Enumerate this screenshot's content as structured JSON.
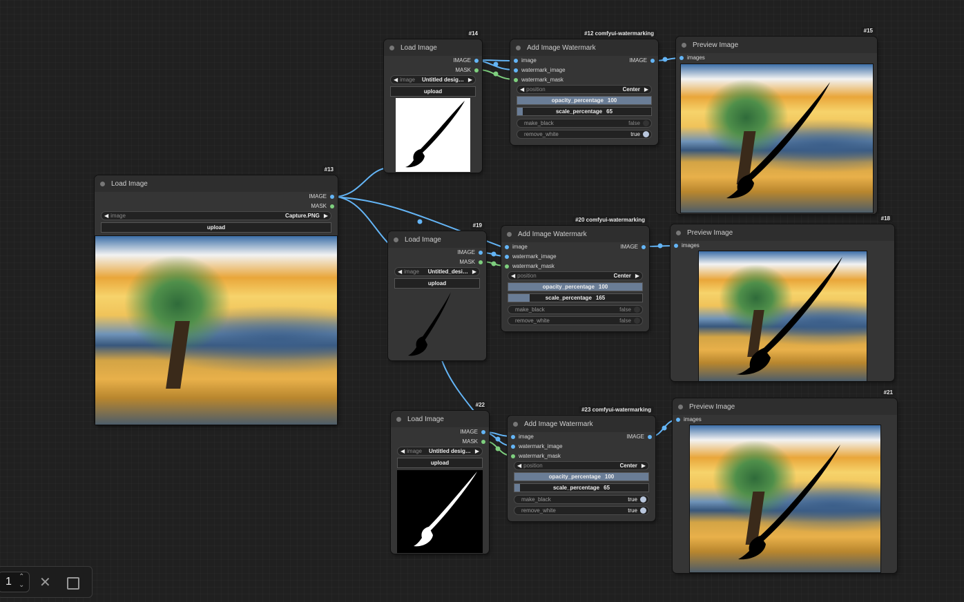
{
  "nodes": {
    "load13": {
      "badge": "#13",
      "title": "Load Image",
      "outputs": [
        "IMAGE",
        "MASK"
      ],
      "image_label": "image",
      "image_value": "Capture.PNG",
      "upload": "upload"
    },
    "load14": {
      "badge": "#14",
      "title": "Load Image",
      "outputs": [
        "IMAGE",
        "MASK"
      ],
      "image_label": "image",
      "image_value": "Untitled desig…",
      "upload": "upload"
    },
    "load19": {
      "badge": "#19",
      "title": "Load Image",
      "outputs": [
        "IMAGE",
        "MASK"
      ],
      "image_label": "image",
      "image_value": "Untitled_desi…",
      "upload": "upload"
    },
    "load22": {
      "badge": "#22",
      "title": "Load Image",
      "outputs": [
        "IMAGE",
        "MASK"
      ],
      "image_label": "image",
      "image_value": "Untitled desig…",
      "upload": "upload"
    },
    "wm12": {
      "badge": "#12 comfyui-watermarking",
      "title": "Add Image Watermark",
      "inputs": [
        "image",
        "watermark_image",
        "watermark_mask"
      ],
      "output": "IMAGE",
      "position_label": "position",
      "position_value": "Center",
      "opacity_label": "opacity_percentage",
      "opacity_value": "100",
      "opacity_fraction": 1.0,
      "scale_label": "scale_percentage",
      "scale_value": "65",
      "scale_fraction": 0.04,
      "make_black_label": "make_black",
      "make_black_value": "false",
      "remove_white_label": "remove_white",
      "remove_white_value": "true"
    },
    "wm20": {
      "badge": "#20 comfyui-watermarking",
      "title": "Add Image Watermark",
      "inputs": [
        "image",
        "watermark_image",
        "watermark_mask"
      ],
      "output": "IMAGE",
      "position_label": "position",
      "position_value": "Center",
      "opacity_label": "opacity_percentage",
      "opacity_value": "100",
      "opacity_fraction": 1.0,
      "scale_label": "scale_percentage",
      "scale_value": "165",
      "scale_fraction": 0.16,
      "make_black_label": "make_black",
      "make_black_value": "false",
      "remove_white_label": "remove_white",
      "remove_white_value": "false"
    },
    "wm23": {
      "badge": "#23 comfyui-watermarking",
      "title": "Add Image Watermark",
      "inputs": [
        "image",
        "watermark_image",
        "watermark_mask"
      ],
      "output": "IMAGE",
      "position_label": "position",
      "position_value": "Center",
      "opacity_label": "opacity_percentage",
      "opacity_value": "100",
      "opacity_fraction": 1.0,
      "scale_label": "scale_percentage",
      "scale_value": "65",
      "scale_fraction": 0.04,
      "make_black_label": "make_black",
      "make_black_value": "true",
      "remove_white_label": "remove_white",
      "remove_white_value": "true"
    },
    "prev15": {
      "badge": "#15",
      "title": "Preview Image",
      "input": "images"
    },
    "prev18": {
      "badge": "#18",
      "title": "Preview Image",
      "input": "images"
    },
    "prev21": {
      "badge": "#21",
      "title": "Preview Image",
      "input": "images"
    }
  },
  "toolbar": {
    "count": "1",
    "stepper_up": "⌃",
    "stepper_down": "⌄",
    "close": "✕"
  },
  "colors": {
    "canvas": "#202020",
    "node": "#353535",
    "image_link": "#64b5f6",
    "mask_link": "#7ecf7e"
  }
}
